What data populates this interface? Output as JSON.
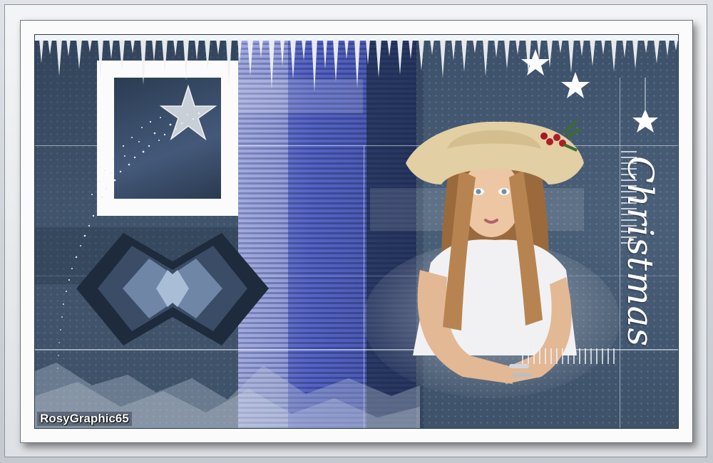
{
  "artwork": {
    "signature_text": "RosyGraphic65",
    "title_text": "Christmas",
    "theme": "winter christmas collage",
    "colors": {
      "background_blue": "#44597a",
      "stripe_blue": "#5a66c8",
      "frame_white": "#fbfbfb",
      "text_white": "#ffffff"
    },
    "icons": [
      "star-icon",
      "shooting-star-icon",
      "icicles",
      "mountains",
      "bowtie-shape"
    ]
  }
}
